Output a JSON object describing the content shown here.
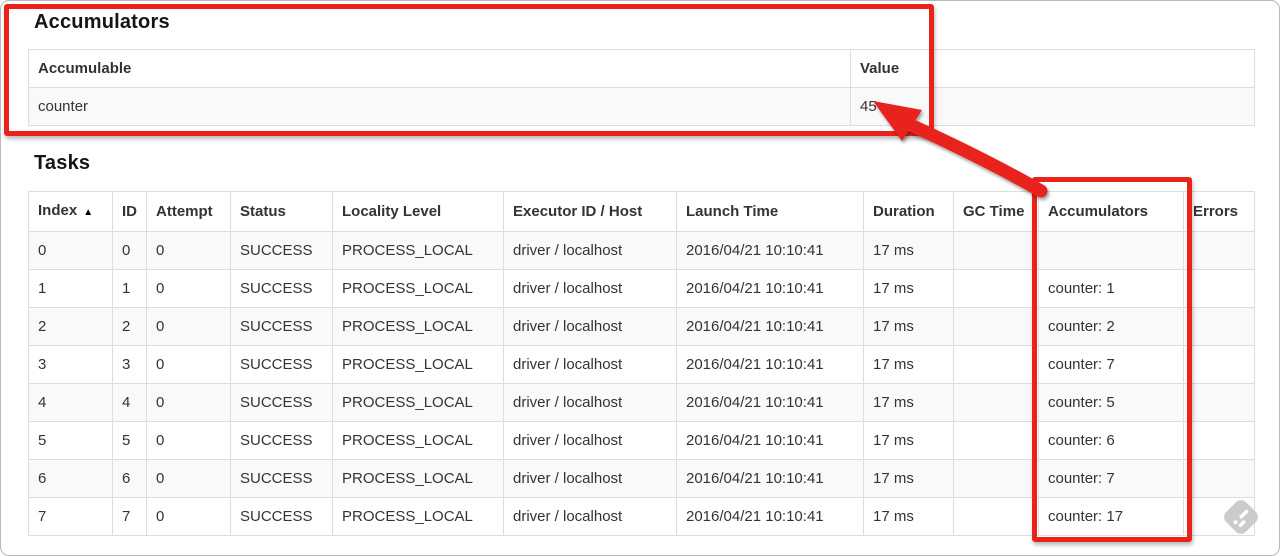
{
  "accumulators": {
    "title": "Accumulators",
    "headers": [
      "Accumulable",
      "Value"
    ],
    "rows": [
      {
        "name": "counter",
        "value": "45"
      }
    ]
  },
  "tasks": {
    "title": "Tasks",
    "sort_arrow": "▲",
    "headers": [
      "Index",
      "ID",
      "Attempt",
      "Status",
      "Locality Level",
      "Executor ID / Host",
      "Launch Time",
      "Duration",
      "GC Time",
      "Accumulators",
      "Errors"
    ],
    "rows": [
      [
        "0",
        "0",
        "0",
        "SUCCESS",
        "PROCESS_LOCAL",
        "driver / localhost",
        "2016/04/21 10:10:41",
        "17 ms",
        "",
        "",
        ""
      ],
      [
        "1",
        "1",
        "0",
        "SUCCESS",
        "PROCESS_LOCAL",
        "driver / localhost",
        "2016/04/21 10:10:41",
        "17 ms",
        "",
        "counter: 1",
        ""
      ],
      [
        "2",
        "2",
        "0",
        "SUCCESS",
        "PROCESS_LOCAL",
        "driver / localhost",
        "2016/04/21 10:10:41",
        "17 ms",
        "",
        "counter: 2",
        ""
      ],
      [
        "3",
        "3",
        "0",
        "SUCCESS",
        "PROCESS_LOCAL",
        "driver / localhost",
        "2016/04/21 10:10:41",
        "17 ms",
        "",
        "counter: 7",
        ""
      ],
      [
        "4",
        "4",
        "0",
        "SUCCESS",
        "PROCESS_LOCAL",
        "driver / localhost",
        "2016/04/21 10:10:41",
        "17 ms",
        "",
        "counter: 5",
        ""
      ],
      [
        "5",
        "5",
        "0",
        "SUCCESS",
        "PROCESS_LOCAL",
        "driver / localhost",
        "2016/04/21 10:10:41",
        "17 ms",
        "",
        "counter: 6",
        ""
      ],
      [
        "6",
        "6",
        "0",
        "SUCCESS",
        "PROCESS_LOCAL",
        "driver / localhost",
        "2016/04/21 10:10:41",
        "17 ms",
        "",
        "counter: 7",
        ""
      ],
      [
        "7",
        "7",
        "0",
        "SUCCESS",
        "PROCESS_LOCAL",
        "driver / localhost",
        "2016/04/21 10:10:41",
        "17 ms",
        "",
        "counter: 17",
        ""
      ]
    ]
  },
  "annotations": {
    "color": "#e8231a",
    "boxed_section": "Accumulators summary",
    "boxed_column": "Accumulators column",
    "arrow_target_value": "45"
  },
  "watermark": {
    "icon": "feedly-watermark-icon",
    "color": "#cbcbcb"
  }
}
